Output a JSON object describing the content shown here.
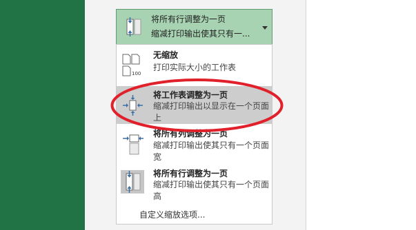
{
  "dropdown": {
    "title": "将所有行调整为一页",
    "description": "缩减打印输出使其只有一..."
  },
  "menu": {
    "items": [
      {
        "title": "无缩放",
        "description": "打印实际大小的工作表",
        "icon": "no-scaling-icon",
        "icon_text": "100"
      },
      {
        "title": "将工作表调整为一页",
        "description": "缩减打印输出以显示在一个页面上",
        "icon": "fit-sheet-icon",
        "selected": true
      },
      {
        "title": "将所有列调整为一页",
        "description": "缩减打印输出使其只有一个页面宽",
        "icon": "fit-columns-icon"
      },
      {
        "title": "将所有行调整为一页",
        "description": "缩减打印输出使其只有一个页面高",
        "icon": "fit-rows-icon"
      }
    ],
    "custom_option": "自定义缩放选项..."
  },
  "colors": {
    "accent_green": "#217346",
    "selected_bg": "#a7d3b2",
    "highlight_ellipse": "#e0202a"
  }
}
